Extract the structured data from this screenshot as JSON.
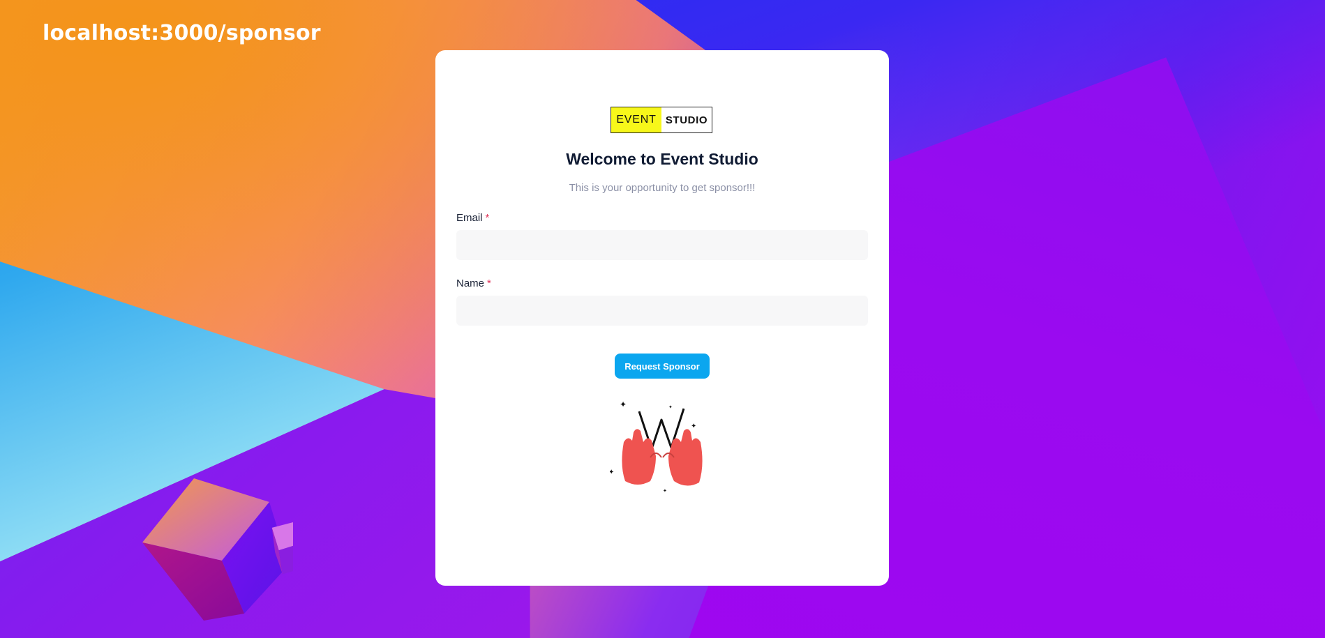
{
  "url_label": "localhost:3000/sponsor",
  "logo": {
    "part1": "EVENT",
    "part2": "STUDIO"
  },
  "title": "Welcome to Event Studio",
  "subtitle": "This is your opportunity to get sponsor!!!",
  "form": {
    "email": {
      "label": "Email",
      "required_mark": "*",
      "value": "",
      "placeholder": ""
    },
    "name": {
      "label": "Name",
      "required_mark": "*",
      "value": "",
      "placeholder": ""
    }
  },
  "button": {
    "label": "Request Sponsor"
  },
  "colors": {
    "accent": "#0ba6ef",
    "logo_highlight": "#f7f71a",
    "required": "#e0365a",
    "illustration_hands": "#ef5350"
  },
  "illustration": "crossed-fingers-icon"
}
